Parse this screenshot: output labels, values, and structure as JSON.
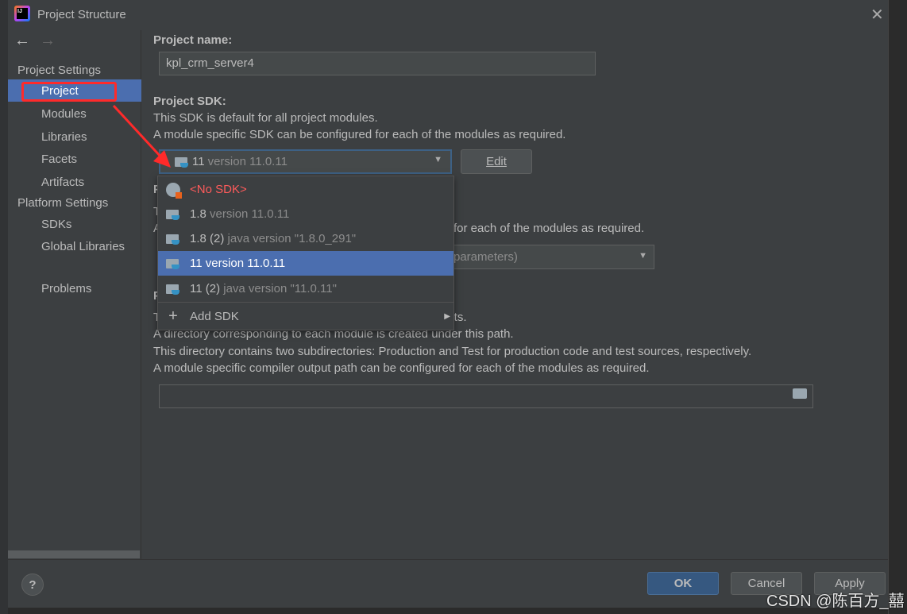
{
  "window": {
    "title": "Project Structure"
  },
  "sidebar": {
    "project_settings": "Project Settings",
    "items": [
      {
        "label": "Project"
      },
      {
        "label": "Modules"
      },
      {
        "label": "Libraries"
      },
      {
        "label": "Facets"
      },
      {
        "label": "Artifacts"
      }
    ],
    "platform_settings": "Platform Settings",
    "platform_items": [
      {
        "label": "SDKs"
      },
      {
        "label": "Global Libraries"
      }
    ],
    "problems": "Problems"
  },
  "main": {
    "name_label": "Project name:",
    "name_value": "kpl_crm_server4",
    "sdk_label": "Project SDK:",
    "sdk_desc1": "This SDK is default for all project modules.",
    "sdk_desc2": "A module specific SDK can be configured for each of the modules as required.",
    "sdk_selected_main": "11",
    "sdk_selected_detail": "version 11.0.11",
    "edit_label": "Edit",
    "lang_heading_fragment": "P",
    "lang_line1_fragment": "T",
    "lang_line2_fragment": "A",
    "lang_line2_tail": "for each of the modules as required.",
    "lang_dropdown_tail": "parameters)",
    "out_heading_fragment": "P",
    "out_line1_fragment": "T",
    "out_line1_tail": "ults.",
    "out_line2": "A directory corresponding to each module is created under this path.",
    "out_line3": "This directory contains two subdirectories: Production and Test for production code and test sources, respectively.",
    "out_line4": "A module specific compiler output path can be configured for each of the modules as required.",
    "out_path_value": ""
  },
  "sdk_popup": {
    "items": [
      {
        "main": "<No SDK>",
        "detail": "",
        "icon": "globe-icon"
      },
      {
        "main": "1.8",
        "detail": "version 11.0.11",
        "icon": "jdk-folder-icon"
      },
      {
        "main": "1.8 (2)",
        "detail": "java version \"1.8.0_291\"",
        "icon": "jdk-folder-icon"
      },
      {
        "main": "11 version 11.0.11",
        "detail": "",
        "icon": "jdk-folder-icon",
        "selected": true
      },
      {
        "main": "11 (2)",
        "detail": "java version \"11.0.11\"",
        "icon": "jdk-folder-icon"
      }
    ],
    "add_sdk": "Add SDK"
  },
  "footer": {
    "help": "?",
    "ok": "OK",
    "cancel": "Cancel",
    "apply": "Apply"
  },
  "watermark": "CSDN @陈百方_囍",
  "colors": {
    "selection": "#4b6eaf",
    "no_sdk": "#ff5b5b",
    "annotation": "#ff2a2a",
    "ok": "#365880"
  }
}
